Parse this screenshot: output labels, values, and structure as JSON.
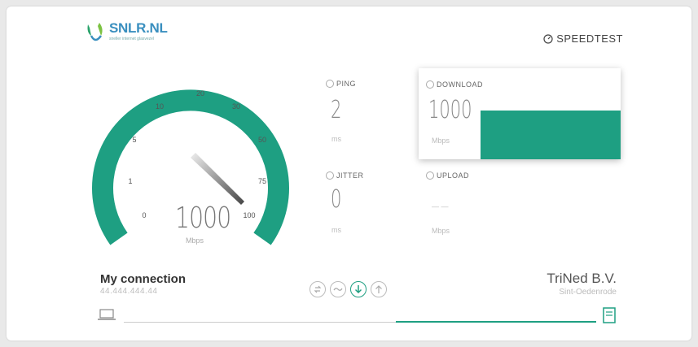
{
  "brand": {
    "name_main": "SNLR",
    "name_suffix": ".NL",
    "tagline": "sneller internet glasvezel"
  },
  "header": {
    "title": "SPEEDTEST"
  },
  "gauge": {
    "ticks": [
      "0",
      "1",
      "5",
      "10",
      "20",
      "30",
      "50",
      "75",
      "100"
    ],
    "value": "1000",
    "unit": "Mbps",
    "fill_fraction": 1.0,
    "color": "#1e9f82"
  },
  "ping": {
    "label": "PING",
    "value": "2",
    "unit": "ms"
  },
  "jitter": {
    "label": "JITTER",
    "value": "0",
    "unit": "ms"
  },
  "download": {
    "label": "DOWNLOAD",
    "value": "1000",
    "unit": "Mbps"
  },
  "upload": {
    "label": "UPLOAD",
    "value": "— —",
    "unit": "Mbps"
  },
  "connection": {
    "title": "My connection",
    "ip": "44.444.444.44"
  },
  "isp": {
    "name": "TriNed B.V.",
    "location": "Sint-Oedenrode"
  },
  "steps": [
    {
      "icon": "arrows-exchange-icon",
      "state": "done"
    },
    {
      "icon": "wave-icon",
      "state": "done"
    },
    {
      "icon": "download-arrow-icon",
      "state": "active"
    },
    {
      "icon": "upload-arrow-icon",
      "state": "pending"
    }
  ],
  "progress": {
    "fraction": 0.43
  },
  "colors": {
    "accent": "#1e9f82"
  }
}
